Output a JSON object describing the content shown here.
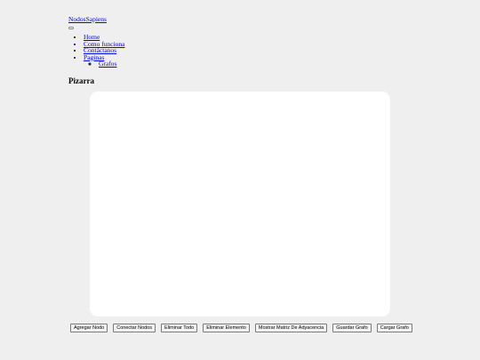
{
  "navbar": {
    "brand": "NodosSapiens",
    "items": [
      {
        "label": "Home"
      },
      {
        "label": "Como funciona"
      },
      {
        "label": "Contáctanos"
      },
      {
        "label": "Paginas",
        "children": [
          {
            "label": "Grafos"
          }
        ]
      }
    ]
  },
  "main": {
    "title": "Pizarra"
  },
  "toolbar": {
    "buttons": [
      {
        "label": "Agregar Nodo"
      },
      {
        "label": "Conectar Nodos"
      },
      {
        "label": "Eliminar Todo"
      },
      {
        "label": "Eliminar Elemento"
      },
      {
        "label": "Mostrar Matriz De Adyacencia"
      },
      {
        "label": "Guardar Grafo"
      },
      {
        "label": "Cargar Grafo"
      }
    ]
  },
  "colors": {
    "background": "#efefef",
    "board": "#ffffff",
    "link": "#0000ee"
  }
}
